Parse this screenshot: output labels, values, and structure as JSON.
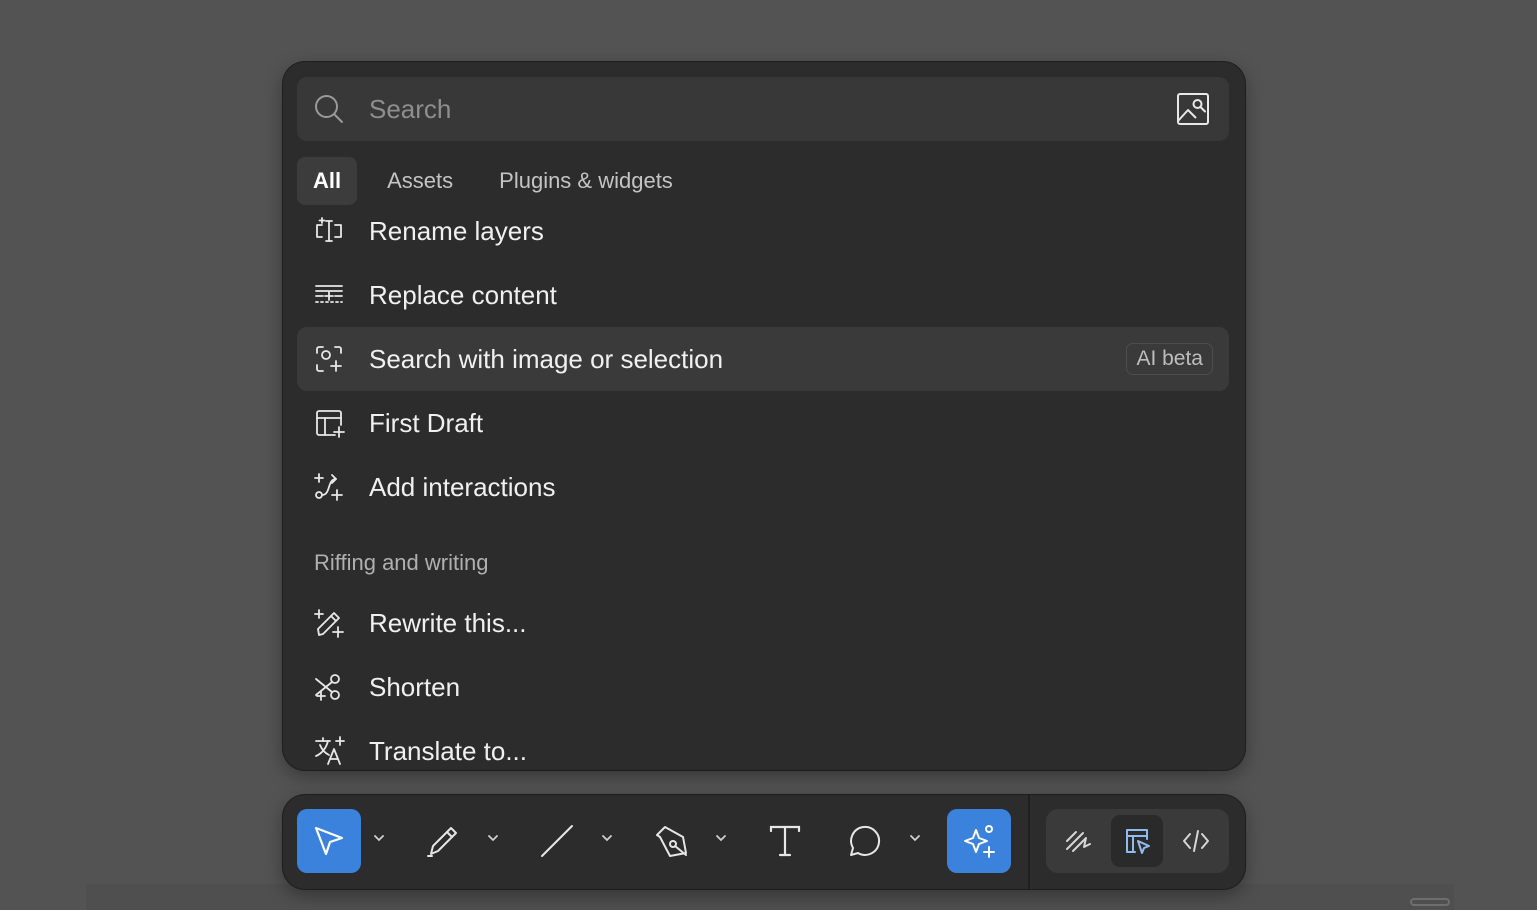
{
  "search": {
    "placeholder": "Search",
    "value": ""
  },
  "tabs": [
    {
      "label": "All",
      "active": true
    },
    {
      "label": "Assets",
      "active": false
    },
    {
      "label": "Plugins & widgets",
      "active": false
    }
  ],
  "actions": [
    {
      "label": "Rename layers",
      "icon": "rename-icon"
    },
    {
      "label": "Replace content",
      "icon": "replace-content-icon"
    },
    {
      "label": "Search with image or selection",
      "icon": "visual-search-icon",
      "badge": "AI beta",
      "highlighted": true
    },
    {
      "label": "First Draft",
      "icon": "first-draft-icon"
    },
    {
      "label": "Add interactions",
      "icon": "interactions-icon"
    }
  ],
  "section": {
    "title": "Riffing and writing",
    "items": [
      {
        "label": "Rewrite this...",
        "icon": "rewrite-wand-icon"
      },
      {
        "label": "Shorten",
        "icon": "shorten-scissors-icon"
      },
      {
        "label": "Translate to...",
        "icon": "translate-icon"
      }
    ]
  },
  "toolbar": {
    "tools": [
      {
        "name": "move-tool",
        "icon": "cursor-icon",
        "active": true
      },
      {
        "name": "pencil-tool",
        "icon": "pencil-icon"
      },
      {
        "name": "line-tool",
        "icon": "line-icon"
      },
      {
        "name": "pen-tool",
        "icon": "pen-nib-icon"
      },
      {
        "name": "text-tool",
        "icon": "text-icon"
      },
      {
        "name": "comment-tool",
        "icon": "comment-icon"
      },
      {
        "name": "ai-actions-tool",
        "icon": "sparkle-icon",
        "active": true
      }
    ],
    "modes": [
      {
        "name": "draw-mode",
        "icon": "draw-icon"
      },
      {
        "name": "design-mode",
        "icon": "design-icon",
        "active": true
      },
      {
        "name": "dev-mode",
        "icon": "code-icon"
      }
    ]
  },
  "colors": {
    "accent": "#3b82dc",
    "panel": "#2c2c2c",
    "canvas": "#535353"
  }
}
